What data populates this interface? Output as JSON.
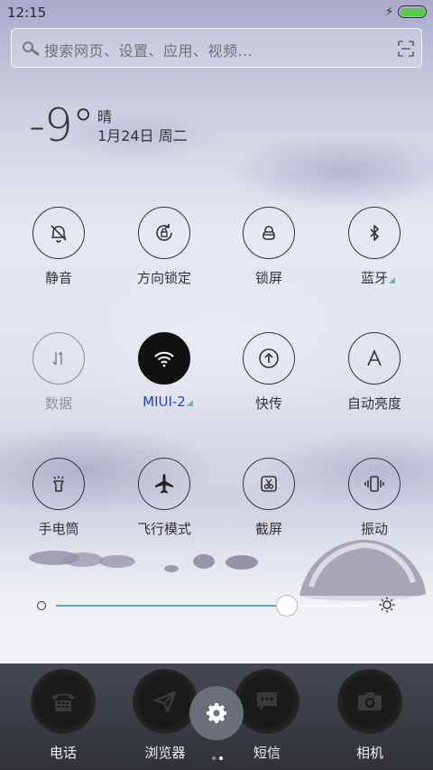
{
  "status_bar": {
    "time": "12:15",
    "charging": true,
    "battery_color": "#4dd23b"
  },
  "search": {
    "placeholder": "搜索网页、设置、应用、视频..."
  },
  "weather": {
    "temperature": "-9°",
    "condition": "晴",
    "date": "1月24日 周二"
  },
  "toggles": [
    {
      "label": "静音",
      "icon": "bell-off-icon",
      "state": "off"
    },
    {
      "label": "方向锁定",
      "icon": "rotation-lock-icon",
      "state": "off"
    },
    {
      "label": "锁屏",
      "icon": "lock-icon",
      "state": "off"
    },
    {
      "label": "蓝牙",
      "icon": "bluetooth-icon",
      "state": "off",
      "has_more": true
    },
    {
      "label": "数据",
      "icon": "mobile-data-icon",
      "state": "disabled"
    },
    {
      "label": "MIUI-2",
      "icon": "wifi-icon",
      "state": "active",
      "has_more": true
    },
    {
      "label": "快传",
      "icon": "quick-transfer-icon",
      "state": "off"
    },
    {
      "label": "自动亮度",
      "icon": "auto-brightness-icon",
      "state": "off"
    },
    {
      "label": "手电筒",
      "icon": "flashlight-icon",
      "state": "off"
    },
    {
      "label": "飞行模式",
      "icon": "airplane-icon",
      "state": "off"
    },
    {
      "label": "截屏",
      "icon": "screenshot-icon",
      "state": "off"
    },
    {
      "label": "振动",
      "icon": "vibrate-icon",
      "state": "off"
    }
  ],
  "brightness": {
    "level": 0.74,
    "track_color": "#4fa8c8"
  },
  "dock": {
    "apps": [
      {
        "label": "电话",
        "icon": "phone-icon"
      },
      {
        "label": "浏览器",
        "icon": "browser-icon"
      },
      {
        "label": "短信",
        "icon": "messages-icon"
      },
      {
        "label": "相机",
        "icon": "camera-icon"
      }
    ],
    "settings_icon": "gear-icon",
    "pages": 2,
    "current_page": 2
  },
  "accent_color": "#1f46c8"
}
